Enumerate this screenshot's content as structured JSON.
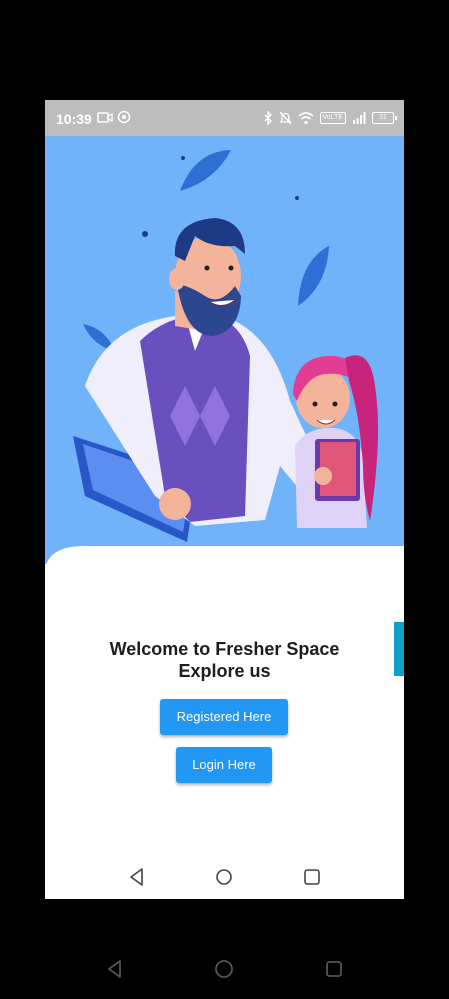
{
  "status_bar": {
    "time": "10:39",
    "network_label": "VoLTE",
    "battery_level": "31",
    "icons": [
      "video-icon",
      "sync-icon",
      "bluetooth-icon",
      "bell-off-icon",
      "wifi-icon",
      "signal-icon",
      "battery-icon"
    ]
  },
  "welcome": {
    "line1": "Welcome to Fresher Space",
    "line2": "Explore us"
  },
  "buttons": {
    "register": "Registered Here",
    "login": "Login Here"
  },
  "nav": {
    "icons": [
      "back-icon",
      "home-icon",
      "recents-icon"
    ]
  },
  "colors": {
    "hero_background": "#70b3f8",
    "button": "#2196f3",
    "status_bar": "#bdbdbd",
    "side_tab": "#0ea0c8"
  }
}
